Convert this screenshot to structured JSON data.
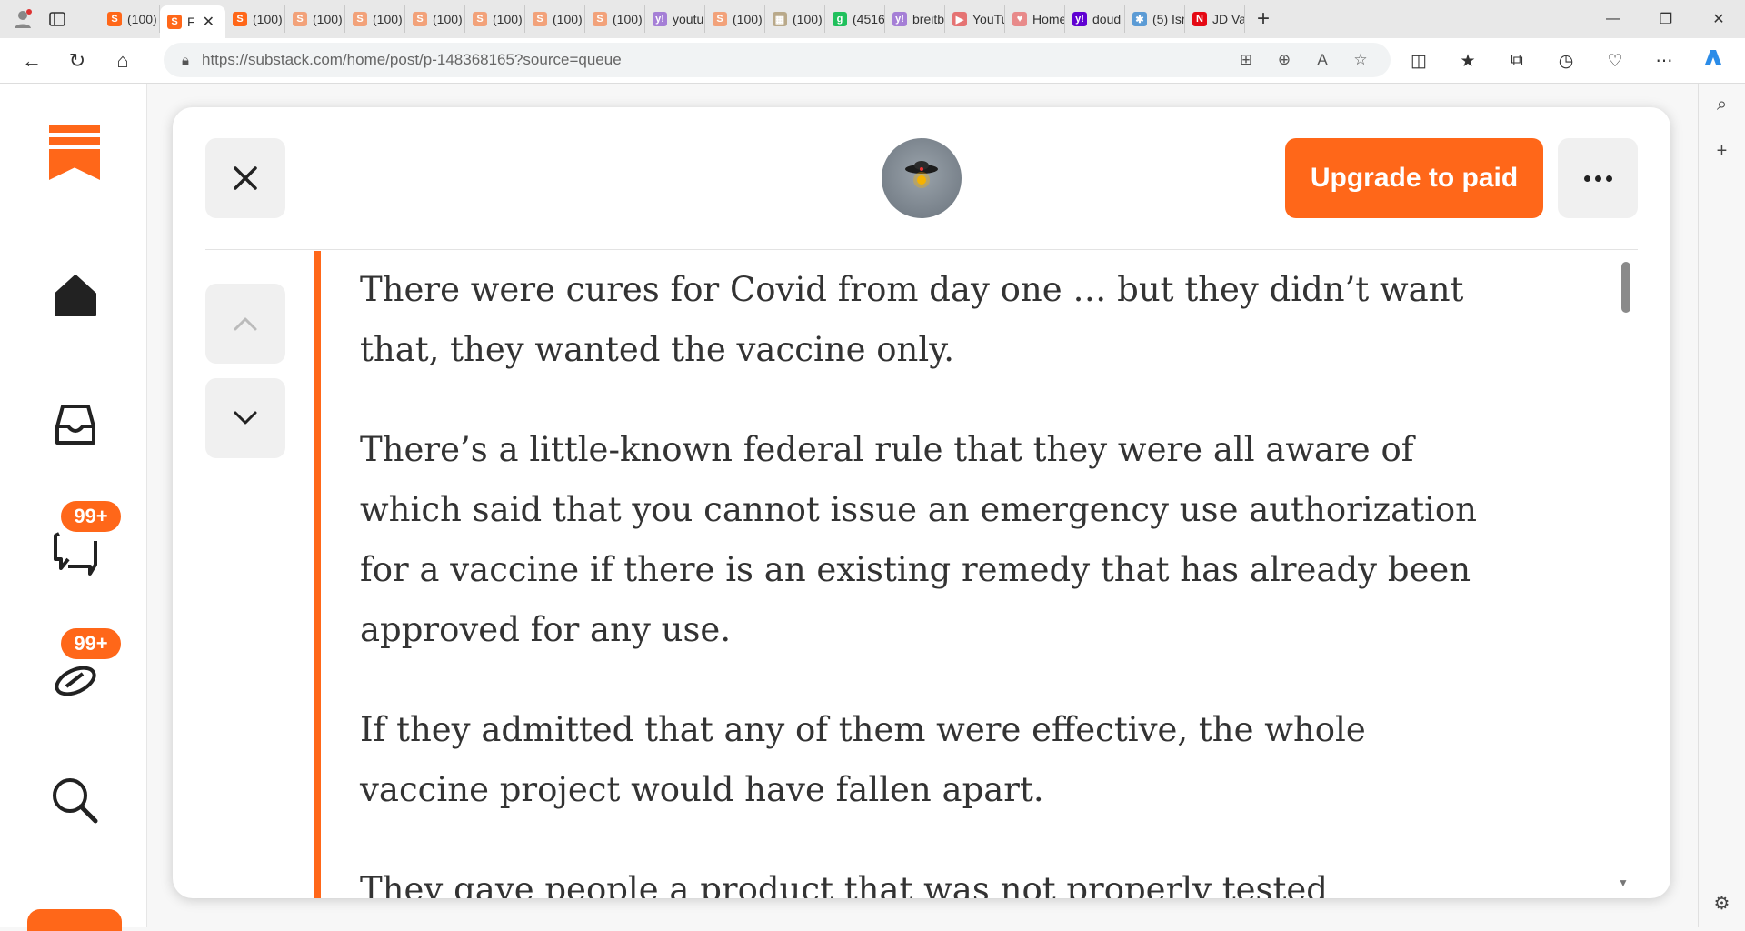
{
  "browser": {
    "tabs": [
      {
        "label": "(100)",
        "fav": "S",
        "fav_color": "#ff6719",
        "active": false
      },
      {
        "label": "F",
        "fav": "S",
        "fav_color": "#ff6719",
        "active": true
      },
      {
        "label": "(100)",
        "fav": "S",
        "fav_color": "#ff6719",
        "active": false
      },
      {
        "label": "(100)",
        "fav": "S",
        "fav_color": "#f2a27a",
        "active": false
      },
      {
        "label": "(100)",
        "fav": "S",
        "fav_color": "#f2a27a",
        "active": false
      },
      {
        "label": "(100)",
        "fav": "S",
        "fav_color": "#f2a27a",
        "active": false
      },
      {
        "label": "(100)",
        "fav": "S",
        "fav_color": "#f2a27a",
        "active": false
      },
      {
        "label": "(100)",
        "fav": "S",
        "fav_color": "#f2a27a",
        "active": false
      },
      {
        "label": "(100)",
        "fav": "S",
        "fav_color": "#f2a27a",
        "active": false
      },
      {
        "label": "youtu",
        "fav": "y!",
        "fav_color": "#a57fd6",
        "active": false
      },
      {
        "label": "(100)",
        "fav": "S",
        "fav_color": "#f2a27a",
        "active": false
      },
      {
        "label": "(100)",
        "fav": "▦",
        "fav_color": "#b9a98a",
        "active": false
      },
      {
        "label": "(4516",
        "fav": "g",
        "fav_color": "#20c05c",
        "active": false
      },
      {
        "label": "breitb",
        "fav": "y!",
        "fav_color": "#a57fd6",
        "active": false
      },
      {
        "label": "YouTu",
        "fav": "▶",
        "fav_color": "#e57373",
        "active": false
      },
      {
        "label": "Home",
        "fav": "♥",
        "fav_color": "#e88a8a",
        "active": false
      },
      {
        "label": "doud",
        "fav": "y!",
        "fav_color": "#6001d2",
        "active": false
      },
      {
        "label": "(5) Isr",
        "fav": "✱",
        "fav_color": "#5b9bd5",
        "active": false
      },
      {
        "label": "JD Va",
        "fav": "N",
        "fav_color": "#e50914",
        "active": false
      }
    ],
    "url": "https://substack.com/home/post/p-148368165?source=queue"
  },
  "nav": {
    "badges": [
      "99+",
      "99+"
    ]
  },
  "modal": {
    "upgrade_label": "Upgrade to paid"
  },
  "article": {
    "paragraphs": [
      "There were cures for Covid from day one … but they didn’t want that, they wanted the vaccine only.",
      "There’s a little-known federal rule that they were all aware of which said that you cannot issue an emergency use authorization for a vaccine if there is an existing remedy that has already been approved for any use.",
      "If they admitted that any of them were effective, the whole vaccine project would have fallen apart.",
      "They gave people a product that was not properly tested"
    ]
  },
  "colors": {
    "accent": "#ff6719"
  }
}
